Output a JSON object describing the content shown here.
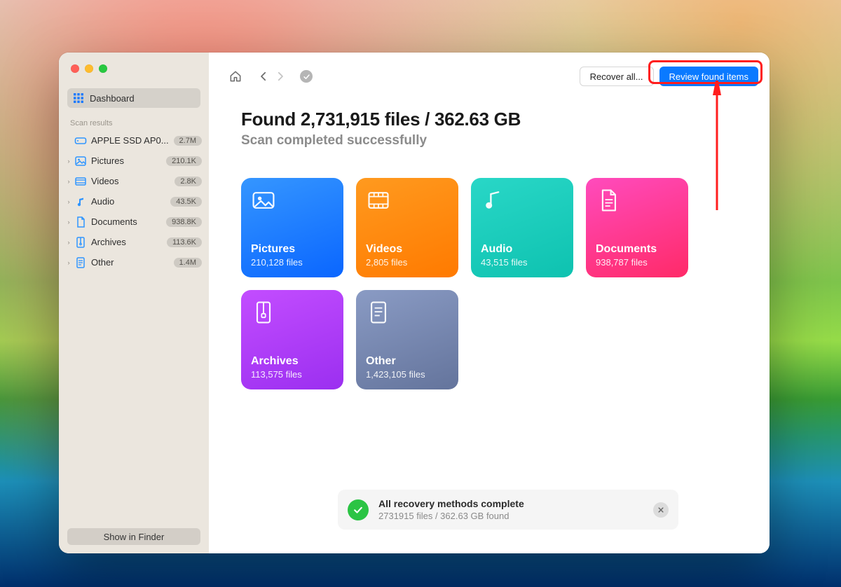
{
  "sidebar": {
    "dashboard_label": "Dashboard",
    "section_label": "Scan results",
    "show_finder_label": "Show in Finder",
    "items": [
      {
        "kind": "disk",
        "label": "APPLE SSD AP0...",
        "badge": "2.7M"
      },
      {
        "kind": "pictures",
        "label": "Pictures",
        "badge": "210.1K"
      },
      {
        "kind": "videos",
        "label": "Videos",
        "badge": "2.8K"
      },
      {
        "kind": "audio",
        "label": "Audio",
        "badge": "43.5K"
      },
      {
        "kind": "documents",
        "label": "Documents",
        "badge": "938.8K"
      },
      {
        "kind": "archives",
        "label": "Archives",
        "badge": "113.6K"
      },
      {
        "kind": "other",
        "label": "Other",
        "badge": "1.4M"
      }
    ]
  },
  "toolbar": {
    "recover_label": "Recover all...",
    "review_label": "Review found items"
  },
  "headline": {
    "title": "Found 2,731,915 files / 362.63 GB",
    "subtitle": "Scan completed successfully"
  },
  "cards": [
    {
      "kind": "pictures",
      "title": "Pictures",
      "count": "210,128 files"
    },
    {
      "kind": "videos",
      "title": "Videos",
      "count": "2,805 files"
    },
    {
      "kind": "audio",
      "title": "Audio",
      "count": "43,515 files"
    },
    {
      "kind": "documents",
      "title": "Documents",
      "count": "938,787 files"
    },
    {
      "kind": "archives",
      "title": "Archives",
      "count": "113,575 files"
    },
    {
      "kind": "other",
      "title": "Other",
      "count": "1,423,105 files"
    }
  ],
  "toast": {
    "title": "All recovery methods complete",
    "subtitle": "2731915 files / 362.63 GB found"
  }
}
